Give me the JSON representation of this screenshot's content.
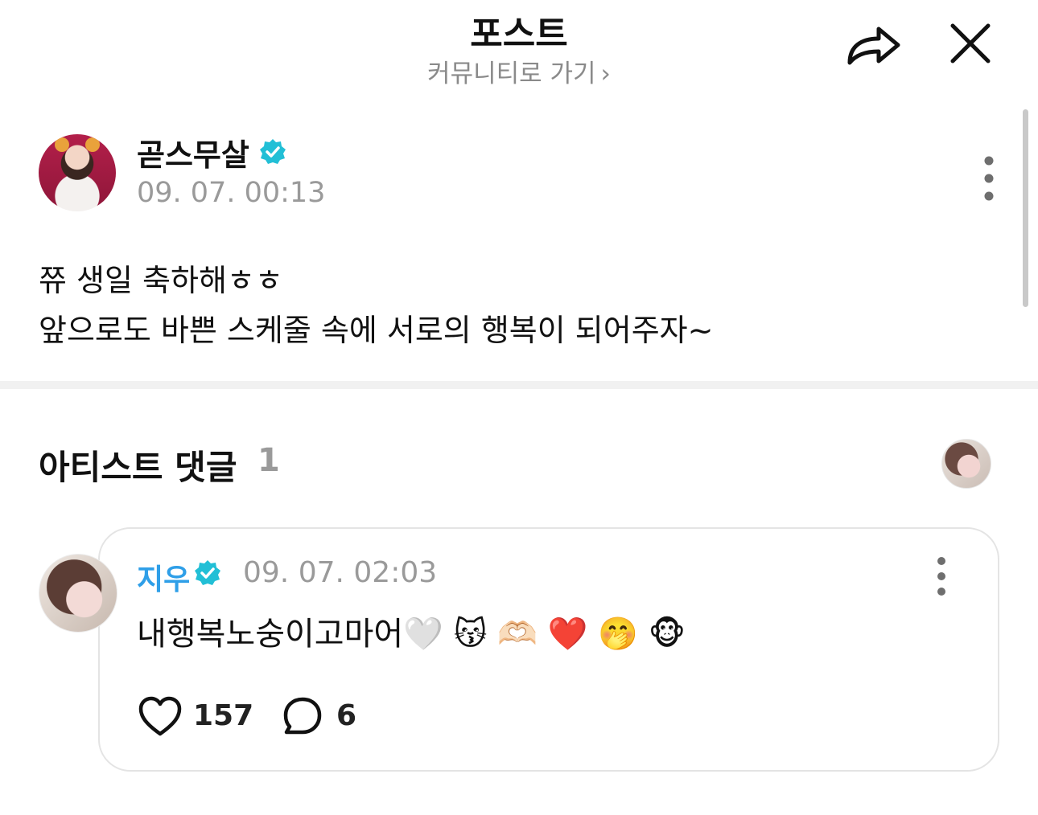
{
  "header": {
    "title": "포스트",
    "community_link": "커뮤니티로 가기",
    "chevron": "›",
    "share_icon": "share-icon",
    "close_icon": "close-icon"
  },
  "post": {
    "author": "곧스무살",
    "verified": true,
    "timestamp": "09. 07. 00:13",
    "lines": [
      "쮸 생일 축하해ㅎㅎ",
      "앞으로도 바쁜 스케줄 속에 서로의 행복이 되어주자~"
    ]
  },
  "artist_comments": {
    "title": "아티스트 댓글",
    "count": "1",
    "comments": [
      {
        "author": "지우",
        "verified": true,
        "timestamp": "09. 07. 02:03",
        "text": "내행복노숭이고마어🤍 😽 🫶🏻 ❤️ 🤭 🐵",
        "likes": "157",
        "replies": "6"
      }
    ]
  },
  "colors": {
    "accent_blue": "#2f9fe8",
    "badge_teal": "#22bfd6",
    "muted_text": "#9a9a9a"
  }
}
